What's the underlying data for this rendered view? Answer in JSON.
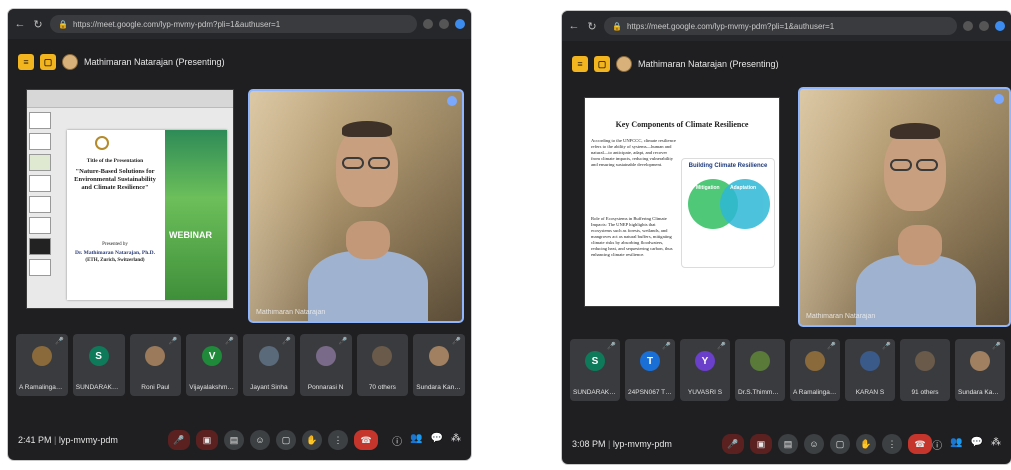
{
  "left": {
    "url": "https://meet.google.com/lyp-mvmy-pdm?pli=1&authuser=1",
    "presenter": "Mathimaran Natarajan (Presenting)",
    "slide": {
      "line1": "Title of the Presentation",
      "line2": "\"Nature-Based Solutions for Environmental Sustainability and Climate Resilience\"",
      "presented_by": "Presented by",
      "speaker": "Dr. Mathimaran Natarajan, Ph.D.",
      "affil": "(ETH, Zurich, Switzerland)",
      "webinar": "WEBINAR"
    },
    "video_label": "Mathimaran Natarajan",
    "tiles": [
      {
        "name": "A RamalingaCha...",
        "initial": "",
        "color": "#8a6a3a"
      },
      {
        "name": "SUNDARAKANN...",
        "initial": "S",
        "color": "#0f7a5a"
      },
      {
        "name": "Roni Paul",
        "initial": "",
        "color": "#9a7a5a"
      },
      {
        "name": "Vijayalakshmi EEE",
        "initial": "V",
        "color": "#1f8a3a"
      },
      {
        "name": "Jayant Sinha",
        "initial": "",
        "color": "#5a6a7a"
      },
      {
        "name": "Ponnarasi N",
        "initial": "",
        "color": "#7a6a8a"
      },
      {
        "name": "70 others",
        "initial": "",
        "color": "#6a5a4a"
      },
      {
        "name": "Sundara Kannan",
        "initial": "",
        "color": "#a08060"
      }
    ],
    "time": "2:41 PM",
    "meeting_code": "lyp-mvmy-pdm"
  },
  "right": {
    "url": "https://meet.google.com/lyp-mvmy-pdm?pli=1&authuser=1",
    "presenter": "Mathimaran Natarajan (Presenting)",
    "slide": {
      "title": "Key Components of Climate Resilience",
      "p1": "According to the UNFCCC, climate resilience refers to the ability of systems—human and natural—to anticipate, adapt, and recover from climate impacts, reducing vulnerability and ensuring sustainable development.",
      "p2": "Role of Ecosystems in Buffering Climate Impacts: The UNEP highlights that ecosystems such as forests, wetlands, and mangroves act as natural buffers, mitigating climate risks by absorbing floodwaters, reducing heat, and sequestering carbon, thus enhancing climate resilience.",
      "diagram_title": "Building Climate Resilience",
      "left_circle": "Mitigation",
      "right_circle": "Adaptation"
    },
    "video_label": "Mathimaran Natarajan",
    "tiles": [
      {
        "name": "SUNDARAKANN...",
        "initial": "S",
        "color": "#0f7a5a"
      },
      {
        "name": "24PSN067 THAN...",
        "initial": "T",
        "color": "#1a6fd6"
      },
      {
        "name": "YUVASRI S",
        "initial": "Y",
        "color": "#6a3fc9"
      },
      {
        "name": "Dr.S.Thimmaraya...",
        "initial": "",
        "color": "#5a7a3a"
      },
      {
        "name": "A RamalingaCha...",
        "initial": "",
        "color": "#8a6a3a"
      },
      {
        "name": "KARAN S",
        "initial": "",
        "color": "#3a5a8a"
      },
      {
        "name": "91 others",
        "initial": "",
        "color": "#6a5a4a"
      },
      {
        "name": "Sundara Kannan",
        "initial": "",
        "color": "#a08060"
      }
    ],
    "time": "3:08 PM",
    "meeting_code": "lyp-mvmy-pdm"
  }
}
